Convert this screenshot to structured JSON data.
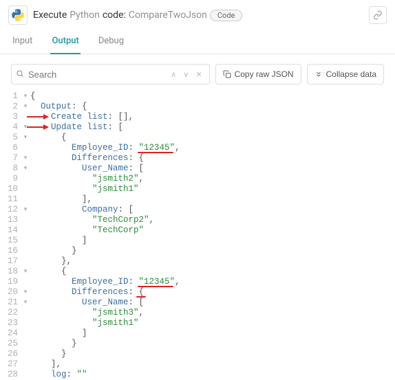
{
  "header": {
    "execute_label": "Execute",
    "python_label": "Python",
    "code_label": "code:",
    "script_name": "CompareTwoJson",
    "code_badge": "Code"
  },
  "tabs": {
    "input": "Input",
    "output": "Output",
    "debug": "Debug"
  },
  "toolbar": {
    "search_placeholder": "Search",
    "copy_label": "Copy raw JSON",
    "collapse_label": "Collapse data"
  },
  "code": {
    "lines": [
      {
        "n": 1,
        "fold": "▾",
        "indent": 0,
        "tokens": [
          {
            "t": "{",
            "c": "brace"
          }
        ]
      },
      {
        "n": 2,
        "fold": "▾",
        "indent": 1,
        "tokens": [
          {
            "t": "Output",
            "c": "key"
          },
          {
            "t": ": {",
            "c": "punc"
          }
        ]
      },
      {
        "n": 3,
        "fold": "",
        "indent": 2,
        "tokens": [
          {
            "t": "Create list",
            "c": "key"
          },
          {
            "t": ": [],",
            "c": "punc"
          }
        ],
        "arrow": true
      },
      {
        "n": 4,
        "fold": "▾",
        "indent": 2,
        "tokens": [
          {
            "t": "Update list",
            "c": "key"
          },
          {
            "t": ": [",
            "c": "punc"
          }
        ],
        "arrow": true
      },
      {
        "n": 5,
        "fold": "▾",
        "indent": 3,
        "tokens": [
          {
            "t": "{",
            "c": "brace"
          }
        ]
      },
      {
        "n": 6,
        "fold": "",
        "indent": 4,
        "tokens": [
          {
            "t": "Employee_ID",
            "c": "key"
          },
          {
            "t": ": ",
            "c": "punc"
          },
          {
            "t": "\"12345\"",
            "c": "str"
          },
          {
            "t": ",",
            "c": "punc"
          }
        ],
        "uline": true
      },
      {
        "n": 7,
        "fold": "▾",
        "indent": 4,
        "tokens": [
          {
            "t": "Differences",
            "c": "key"
          },
          {
            "t": ": {",
            "c": "punc"
          }
        ]
      },
      {
        "n": 8,
        "fold": "▾",
        "indent": 5,
        "tokens": [
          {
            "t": "User_Name",
            "c": "key"
          },
          {
            "t": ": [",
            "c": "punc"
          }
        ]
      },
      {
        "n": 9,
        "fold": "",
        "indent": 6,
        "tokens": [
          {
            "t": "\"jsmith2\"",
            "c": "str"
          },
          {
            "t": ",",
            "c": "punc"
          }
        ]
      },
      {
        "n": 10,
        "fold": "",
        "indent": 6,
        "tokens": [
          {
            "t": "\"jsmith1\"",
            "c": "str"
          }
        ]
      },
      {
        "n": 11,
        "fold": "",
        "indent": 5,
        "tokens": [
          {
            "t": "],",
            "c": "punc"
          }
        ]
      },
      {
        "n": 12,
        "fold": "▾",
        "indent": 5,
        "tokens": [
          {
            "t": "Company",
            "c": "key"
          },
          {
            "t": ": [",
            "c": "punc"
          }
        ]
      },
      {
        "n": 13,
        "fold": "",
        "indent": 6,
        "tokens": [
          {
            "t": "\"TechCorp2\"",
            "c": "str"
          },
          {
            "t": ",",
            "c": "punc"
          }
        ]
      },
      {
        "n": 14,
        "fold": "",
        "indent": 6,
        "tokens": [
          {
            "t": "\"TechCorp\"",
            "c": "str"
          }
        ]
      },
      {
        "n": 15,
        "fold": "",
        "indent": 5,
        "tokens": [
          {
            "t": "]",
            "c": "punc"
          }
        ]
      },
      {
        "n": 16,
        "fold": "",
        "indent": 4,
        "tokens": [
          {
            "t": "}",
            "c": "brace"
          }
        ]
      },
      {
        "n": 17,
        "fold": "",
        "indent": 3,
        "tokens": [
          {
            "t": "},",
            "c": "punc"
          }
        ]
      },
      {
        "n": 18,
        "fold": "▾",
        "indent": 3,
        "tokens": [
          {
            "t": "{",
            "c": "brace"
          }
        ]
      },
      {
        "n": 19,
        "fold": "",
        "indent": 4,
        "tokens": [
          {
            "t": "Employee_ID",
            "c": "key"
          },
          {
            "t": ": ",
            "c": "punc"
          },
          {
            "t": "\"12345\"",
            "c": "str"
          },
          {
            "t": ",",
            "c": "punc"
          }
        ],
        "uline": true
      },
      {
        "n": 20,
        "fold": "▾",
        "indent": 4,
        "tokens": [
          {
            "t": "Differences",
            "c": "key"
          },
          {
            "t": ": {",
            "c": "punc"
          }
        ],
        "uline2": true
      },
      {
        "n": 21,
        "fold": "▾",
        "indent": 5,
        "tokens": [
          {
            "t": "User_Name",
            "c": "key"
          },
          {
            "t": ": [",
            "c": "punc"
          }
        ]
      },
      {
        "n": 22,
        "fold": "",
        "indent": 6,
        "tokens": [
          {
            "t": "\"jsmith3\"",
            "c": "str"
          },
          {
            "t": ",",
            "c": "punc"
          }
        ]
      },
      {
        "n": 23,
        "fold": "",
        "indent": 6,
        "tokens": [
          {
            "t": "\"jsmith1\"",
            "c": "str"
          }
        ]
      },
      {
        "n": 24,
        "fold": "",
        "indent": 5,
        "tokens": [
          {
            "t": "]",
            "c": "punc"
          }
        ]
      },
      {
        "n": 25,
        "fold": "",
        "indent": 4,
        "tokens": [
          {
            "t": "}",
            "c": "brace"
          }
        ]
      },
      {
        "n": 26,
        "fold": "",
        "indent": 3,
        "tokens": [
          {
            "t": "}",
            "c": "brace"
          }
        ]
      },
      {
        "n": 27,
        "fold": "",
        "indent": 2,
        "tokens": [
          {
            "t": "],",
            "c": "punc"
          }
        ]
      },
      {
        "n": 28,
        "fold": "",
        "indent": 2,
        "tokens": [
          {
            "t": "log",
            "c": "key"
          },
          {
            "t": ": ",
            "c": "punc"
          },
          {
            "t": "\"\"",
            "c": "str"
          }
        ]
      }
    ]
  }
}
